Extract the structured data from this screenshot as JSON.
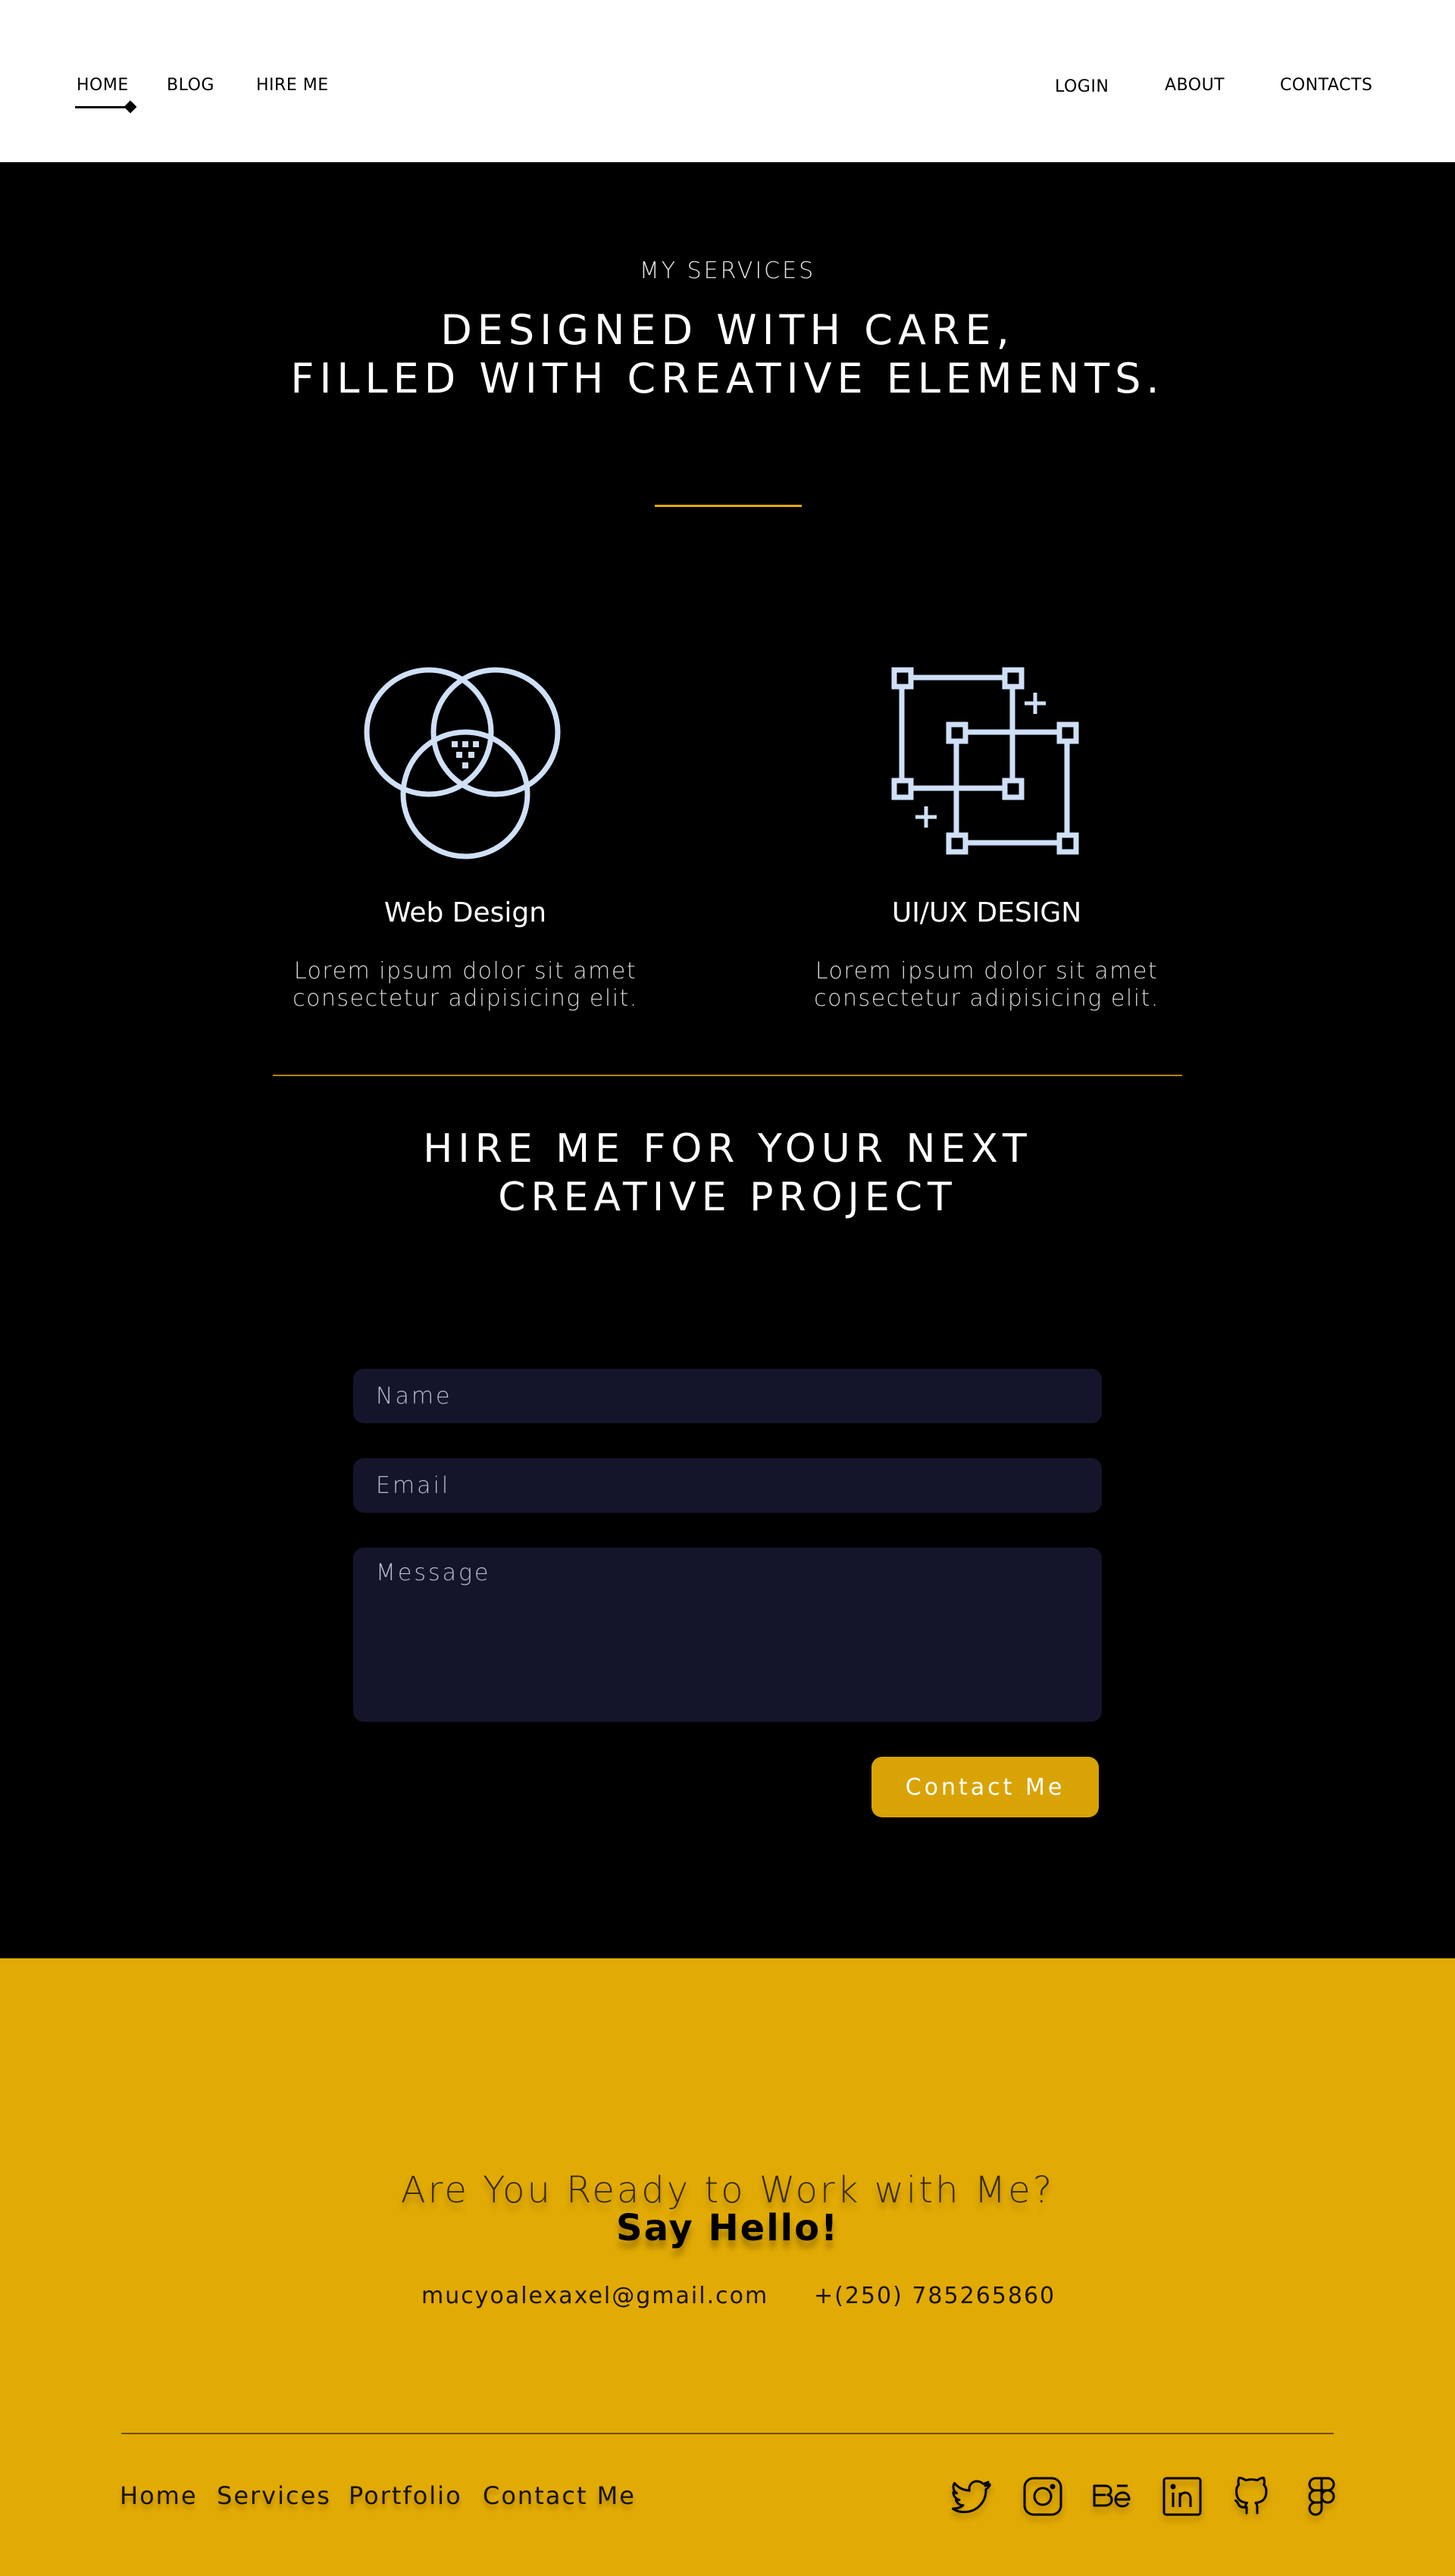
{
  "header": {
    "nav_left": [
      "HOME",
      "BLOG",
      "HIRE ME"
    ],
    "nav_right": [
      "LOGIN",
      "ABOUT",
      "CONTACTS"
    ]
  },
  "services": {
    "eyebrow": "MY SERVICES",
    "headline_line1": "DESIGNED WITH CARE,",
    "headline_line2": "FILLED WITH CREATIVE ELEMENTS.",
    "items": [
      {
        "title": "Web Design",
        "desc_line1": "Lorem ipsum dolor sit amet",
        "desc_line2": "consectetur adipisicing elit.",
        "icon": "venn-diagram-icon"
      },
      {
        "title": "UI/UX DESIGN",
        "desc_line1": "Lorem ipsum dolor sit amet",
        "desc_line2": "consectetur adipisicing elit.",
        "icon": "layout-frames-icon"
      }
    ]
  },
  "hire": {
    "title_line1": "HIRE ME FOR YOUR NEXT",
    "title_line2": "CREATIVE PROJECT",
    "name_placeholder": "Name",
    "email_placeholder": "Email",
    "message_placeholder": "Message",
    "button_label": "Contact Me"
  },
  "footer": {
    "question": "Are You Ready to Work with Me?",
    "hello": "Say Hello!",
    "email": "mucyoalexaxel@gmail.com",
    "phone": "+(250) 785265860",
    "links": [
      "Home",
      "Services",
      "Portfolio",
      "Contact Me"
    ],
    "socials": [
      "twitter-icon",
      "instagram-icon",
      "behance-icon",
      "linkedin-icon",
      "github-icon",
      "figma-icon"
    ]
  },
  "colors": {
    "accent": "#e2aa04",
    "button": "#d9a306",
    "icon_stroke": "#cfe0f7",
    "field_bg": "#14152b",
    "dark_bg": "#000000"
  }
}
